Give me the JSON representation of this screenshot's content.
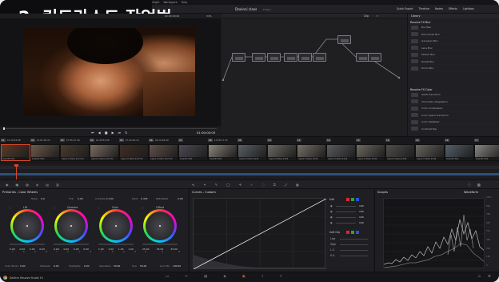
{
  "overlay": {
    "title": "2. 컨트라스트 작업법"
  },
  "menu": {
    "items": [
      "DaVinci Resolve",
      "File",
      "Edit",
      "Trim",
      "Timeline",
      "Clip",
      "Mark",
      "View",
      "Playback",
      "Fusion",
      "Color",
      "Fairlight",
      "Workspace",
      "Help"
    ]
  },
  "header": {
    "project_title": "Davinci class",
    "project_sub": "Edited",
    "right": [
      "Quick Export",
      "Timeline",
      "Nodes",
      "Effects",
      "Lightbox"
    ],
    "library_tab": "Library"
  },
  "viewer": {
    "zoom": "34%",
    "timecode_left": "00:00:00:00",
    "timecode": "01:00:00:05",
    "clip_mode": "Clip"
  },
  "effects": {
    "section1": "Resolve FX Blur",
    "blur_items": [
      "Box Blur",
      "Directional Blur",
      "Gaussian Blur",
      "Lens Blur",
      "Mosaic Blur",
      "Radial Blur",
      "Zoom Blur"
    ],
    "section2": "Resolve FX Color",
    "color_items": [
      "ACES Transform",
      "Chromatic Adaptation",
      "Color Compressor",
      "Color Space Transform",
      "Color Stabilizer",
      "Contrast Pop"
    ]
  },
  "clips": [
    {
      "num": "01",
      "tc": "01:59:44:08",
      "v": "V1",
      "name": "DaerIB HQX"
    },
    {
      "num": "02",
      "tc": "01:01:56:13",
      "v": "V1",
      "name": "DaerIB HQX"
    },
    {
      "num": "03",
      "tc": "07:05:47:16",
      "v": "V1",
      "name": "Apple ProRes 422 HQ"
    },
    {
      "num": "04",
      "tc": "01:28:53:06",
      "v": "V1",
      "name": "Apple ProRes 422 HQ"
    },
    {
      "num": "05",
      "tc": "07:24:29:14",
      "v": "V1",
      "name": "Apple ProRes 422 HQ"
    },
    {
      "num": "06",
      "tc": "04:15:26:09",
      "v": "V1",
      "name": "Apple ProRes 422 HQ"
    },
    {
      "num": "07",
      "tc": "",
      "v": "V1",
      "name": "DaerIB HQX"
    },
    {
      "num": "08",
      "tc": "11:58:17:15",
      "v": "V1",
      "name": "DaerIB HQX"
    },
    {
      "num": "09",
      "tc": "",
      "v": "V1",
      "name": "Apple ProRes 4444"
    },
    {
      "num": "10",
      "tc": "",
      "v": "V1",
      "name": "Apple ProRes 4444"
    },
    {
      "num": "11",
      "tc": "",
      "v": "V1",
      "name": "Apple ProRes 4444"
    },
    {
      "num": "12",
      "tc": "",
      "v": "V1",
      "name": "Apple ProRes 4444"
    },
    {
      "num": "13",
      "tc": "",
      "v": "V1",
      "name": "Apple ProRes 4444"
    },
    {
      "num": "14",
      "tc": "",
      "v": "V1",
      "name": "Apple ProRes 4444"
    },
    {
      "num": "15",
      "tc": "",
      "v": "V1",
      "name": "Apple ProRes 4444"
    },
    {
      "num": "16",
      "tc": "",
      "v": "V1",
      "name": "DaerIB HQX"
    },
    {
      "num": "17",
      "tc": "",
      "v": "V1",
      "name": "DaerIB HQX"
    }
  ],
  "primaries": {
    "title": "Primaries - Color Wheels",
    "temp_label": "Temp",
    "temp": "0.0",
    "tint_label": "Tint",
    "tint": "0.00",
    "contrast_label": "Contrast",
    "contrast": "1.130",
    "pivot_label": "Pivot",
    "pivot": "0.435",
    "md_label": "Mid/Detail",
    "md": "0.00",
    "wheels": [
      {
        "name": "Lift",
        "values": [
          "0.00",
          "0.00",
          "0.00",
          "0.00"
        ]
      },
      {
        "name": "Gamma",
        "values": [
          "0.00",
          "0.00",
          "0.00",
          "0.00"
        ]
      },
      {
        "name": "Gain",
        "values": [
          "1.00",
          "1.00",
          "1.00",
          "1.00"
        ]
      },
      {
        "name": "Offset",
        "values": [
          "25.00",
          "25.00",
          "25.00"
        ]
      }
    ],
    "channels": [
      "Y",
      "R",
      "G",
      "B"
    ],
    "footer": {
      "cb_label": "Color Boost",
      "cb": "0.00",
      "sh_label": "Shadows",
      "sh": "0.00",
      "hl_label": "Highlights",
      "hl": "0.00",
      "sat_label": "Saturation",
      "sat": "50.00",
      "hue_label": "Hue",
      "hue": "50.00",
      "lm_label": "Lum Mix",
      "lm": "100.00"
    }
  },
  "curves": {
    "title": "Curves - Custom",
    "edit_label": "Edit",
    "edit_values": [
      "100",
      "100",
      "100",
      "100"
    ],
    "soft_clip": "Soft Clip",
    "rows": [
      "Low",
      "High",
      "L.S.",
      "H.S."
    ]
  },
  "scopes": {
    "title": "Scopes",
    "mode": "Waveform",
    "ticks": [
      "1023",
      "896",
      "768",
      "640",
      "512",
      "384",
      "256",
      "128",
      "0"
    ]
  },
  "bottom": {
    "app": "DaVinci Resolve Studio 19"
  },
  "colors": {
    "accent": "#d8472a",
    "playhead": "#d8472a",
    "panel": "#222226",
    "bg": "#1b1b1e"
  }
}
